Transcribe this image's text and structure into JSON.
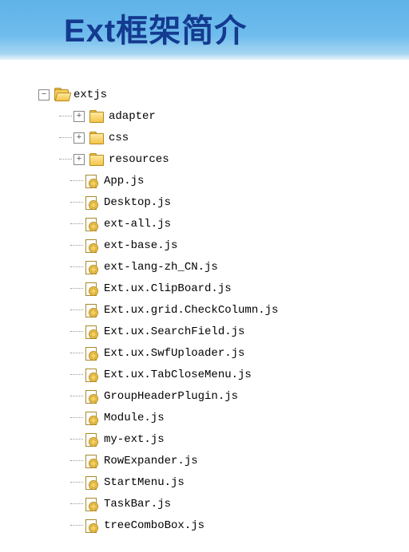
{
  "title": "Ext框架简介",
  "tree": {
    "root": {
      "label": "extjs",
      "icon": "folder-open",
      "expanded": true
    },
    "children": [
      {
        "label": "adapter",
        "icon": "folder-closed",
        "expandable": true
      },
      {
        "label": "css",
        "icon": "folder-closed",
        "expandable": true
      },
      {
        "label": "resources",
        "icon": "folder-closed",
        "expandable": true
      },
      {
        "label": "App.js",
        "icon": "js-file"
      },
      {
        "label": "Desktop.js",
        "icon": "js-file"
      },
      {
        "label": "ext-all.js",
        "icon": "js-file"
      },
      {
        "label": "ext-base.js",
        "icon": "js-file"
      },
      {
        "label": "ext-lang-zh_CN.js",
        "icon": "js-file"
      },
      {
        "label": "Ext.ux.ClipBoard.js",
        "icon": "js-file"
      },
      {
        "label": "Ext.ux.grid.CheckColumn.js",
        "icon": "js-file"
      },
      {
        "label": "Ext.ux.SearchField.js",
        "icon": "js-file"
      },
      {
        "label": "Ext.ux.SwfUploader.js",
        "icon": "js-file"
      },
      {
        "label": "Ext.ux.TabCloseMenu.js",
        "icon": "js-file"
      },
      {
        "label": "GroupHeaderPlugin.js",
        "icon": "js-file"
      },
      {
        "label": "Module.js",
        "icon": "js-file"
      },
      {
        "label": "my-ext.js",
        "icon": "js-file"
      },
      {
        "label": "RowExpander.js",
        "icon": "js-file"
      },
      {
        "label": "StartMenu.js",
        "icon": "js-file"
      },
      {
        "label": "TaskBar.js",
        "icon": "js-file"
      },
      {
        "label": "treeComboBox.js",
        "icon": "js-file"
      }
    ]
  }
}
